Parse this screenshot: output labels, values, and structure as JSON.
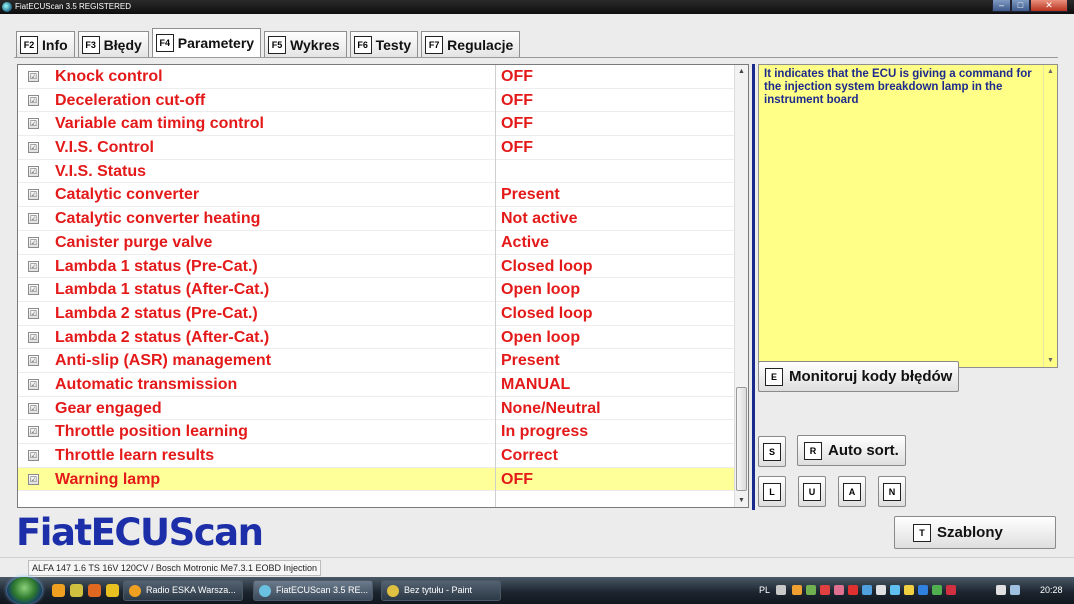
{
  "window": {
    "title": "FiatECUScan 3.5 REGISTERED",
    "controls": [
      "–",
      "□",
      "✕"
    ]
  },
  "tabs": [
    {
      "key": "F2",
      "label": "Info",
      "active": false
    },
    {
      "key": "F3",
      "label": "Błędy",
      "active": false
    },
    {
      "key": "F4",
      "label": "Parametery",
      "active": true
    },
    {
      "key": "F5",
      "label": "Wykres",
      "active": false
    },
    {
      "key": "F6",
      "label": "Testy",
      "active": false
    },
    {
      "key": "F7",
      "label": "Regulacje",
      "active": false
    }
  ],
  "parameters": [
    {
      "name": "Knock control",
      "value": "OFF"
    },
    {
      "name": "Deceleration cut-off",
      "value": "OFF"
    },
    {
      "name": "Variable cam timing control",
      "value": "OFF"
    },
    {
      "name": "V.I.S. Control",
      "value": "OFF"
    },
    {
      "name": "V.I.S. Status",
      "value": ""
    },
    {
      "name": "Catalytic converter",
      "value": "Present"
    },
    {
      "name": "Catalytic converter heating",
      "value": "Not active"
    },
    {
      "name": "Canister purge valve",
      "value": "Active"
    },
    {
      "name": "Lambda 1 status (Pre-Cat.)",
      "value": "Closed loop"
    },
    {
      "name": "Lambda 1 status (After-Cat.)",
      "value": "Open loop"
    },
    {
      "name": "Lambda 2 status (Pre-Cat.)",
      "value": "Closed loop"
    },
    {
      "name": "Lambda 2 status (After-Cat.)",
      "value": "Open loop"
    },
    {
      "name": "Anti-slip (ASR) management",
      "value": "Present"
    },
    {
      "name": "Automatic transmission",
      "value": "MANUAL"
    },
    {
      "name": "Gear engaged",
      "value": "None/Neutral"
    },
    {
      "name": "Throttle position learning",
      "value": "In progress"
    },
    {
      "name": "Throttle learn results",
      "value": "Correct"
    },
    {
      "name": "Warning lamp",
      "value": "OFF",
      "selected": true
    }
  ],
  "checkbox_glyph": "☑",
  "description": "It indicates that the ECU is giving a command for the injection system breakdown lamp in the instrument board",
  "buttons": {
    "monitor": {
      "key": "E",
      "label": "Monitoruj kody błędów"
    },
    "sort_s": {
      "key": "S"
    },
    "auto_sort": {
      "key": "R",
      "label": "Auto sort."
    },
    "l": {
      "key": "L"
    },
    "u": {
      "key": "U"
    },
    "a": {
      "key": "A"
    },
    "n": {
      "key": "N"
    },
    "templates": {
      "key": "T",
      "label": "Szablony"
    }
  },
  "logo": "FiatECUScan",
  "status": "ALFA 147 1.6 TS 16V 120CV / Bosch Motronic Me7.3.1 EOBD Injection",
  "taskbar": {
    "tasks": [
      {
        "label": "Radio ESKA Warsza...",
        "active": false
      },
      {
        "label": "FiatECUScan 3.5 RE...",
        "active": true
      },
      {
        "label": "Bez tytułu - Paint",
        "active": false
      }
    ],
    "lang": "PL",
    "clock": "20:28"
  },
  "colors": {
    "param_text": "#e41a1a",
    "desc_bg": "#ffff88",
    "desc_text": "#1e2a8c",
    "selected_row": "#ffff99",
    "logo": "#1c2ea8"
  }
}
